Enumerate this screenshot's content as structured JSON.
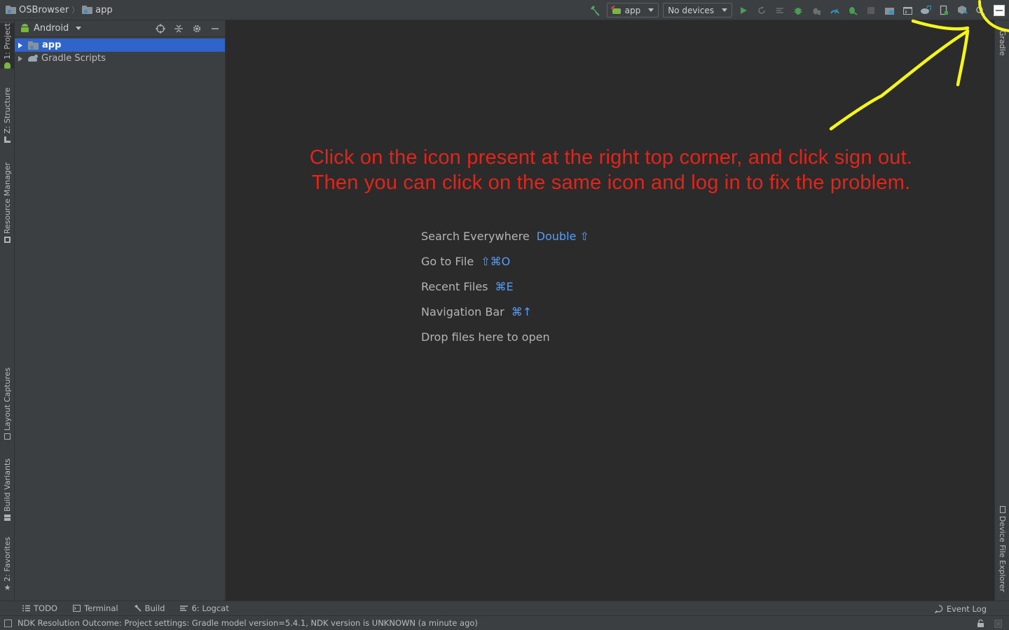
{
  "breadcrumb": {
    "project": "OSBrowser",
    "module": "app"
  },
  "toolbar": {
    "run_config": "app",
    "device_selector": "No devices",
    "icons": [
      "build-hammer-icon",
      "run-icon",
      "apply-changes-icon",
      "apply-code-changes-icon",
      "debug-icon",
      "attach-debugger-icon",
      "profile-icon",
      "attach-process-icon",
      "stop-icon",
      "project-structure-icon",
      "terminal-icon",
      "sync-gradle-icon",
      "avd-manager-icon",
      "sdk-manager-icon",
      "search-icon",
      "account-avatar-icon"
    ]
  },
  "left_tabs": [
    "1: Project",
    "Z: Structure",
    "Resource Manager",
    "Layout Captures",
    "Build Variants",
    "2: Favorites"
  ],
  "right_tabs": [
    "Gradle",
    "Device File Explorer"
  ],
  "project_panel": {
    "view": "Android",
    "tree": [
      {
        "label": "app",
        "selected": true
      },
      {
        "label": "Gradle Scripts",
        "selected": false
      }
    ]
  },
  "editor": {
    "annotation_line1": "Click on the icon present at the right top corner, and click sign out.",
    "annotation_line2": "Then you can click on the same icon and log in to fix the problem.",
    "hints": [
      {
        "label": "Search Everywhere",
        "shortcut": "Double ⇧"
      },
      {
        "label": "Go to File",
        "shortcut": "⇧⌘O"
      },
      {
        "label": "Recent Files",
        "shortcut": "⌘E"
      },
      {
        "label": "Navigation Bar",
        "shortcut": "⌘↑"
      },
      {
        "label": "Drop files here to open",
        "shortcut": ""
      }
    ]
  },
  "bottom_tabs": [
    "TODO",
    "Terminal",
    "Build",
    "6: Logcat"
  ],
  "event_log": "Event Log",
  "status": "NDK Resolution Outcome: Project settings: Gradle model version=5.4.1, NDK version is UNKNOWN (a minute ago)",
  "colors": {
    "annotation": "#e1251b",
    "highlight_stroke": "#f5f51e",
    "selection": "#2f65ca",
    "shortcut": "#589df6"
  }
}
